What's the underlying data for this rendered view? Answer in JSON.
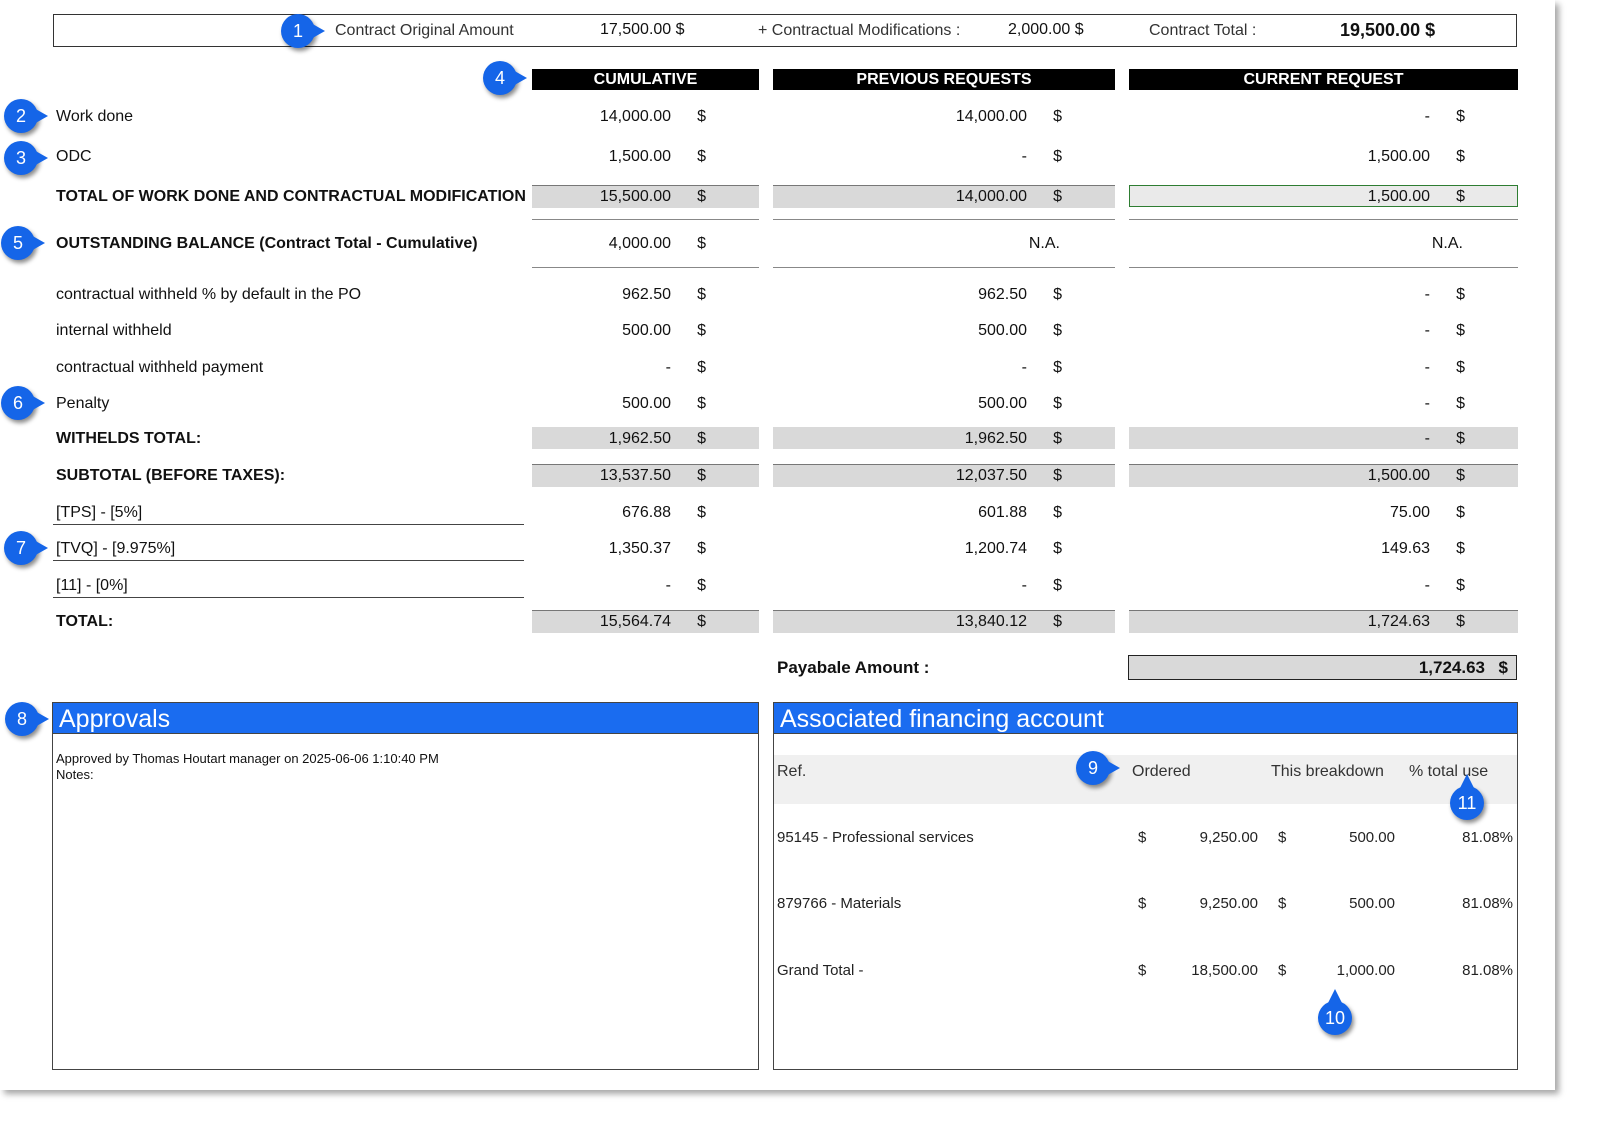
{
  "header": {
    "original_label": "Contract Original Amount",
    "original_value": "17,500.00 $",
    "mods_label": "+ Contractual Modifications :",
    "mods_value": "2,000.00 $",
    "total_label": "Contract Total :",
    "total_value": "19,500.00 $"
  },
  "columns": [
    "CUMULATIVE",
    "PREVIOUS REQUESTS",
    "CURRENT REQUEST"
  ],
  "currency": "$",
  "rows": {
    "work_done": {
      "label": "Work done",
      "values": [
        "14,000.00",
        "14,000.00",
        "-"
      ]
    },
    "odc": {
      "label": "ODC",
      "values": [
        "1,500.00",
        "-",
        "1,500.00"
      ]
    },
    "total_work": {
      "label": "TOTAL OF WORK DONE AND CONTRACTUAL MODIFICATION",
      "values": [
        "15,500.00",
        "14,000.00",
        "1,500.00"
      ]
    },
    "outstanding": {
      "label": "OUTSTANDING BALANCE (Contract Total - Cumulative)",
      "values": [
        "4,000.00",
        "N.A.",
        "N.A."
      ]
    },
    "contract_withheld": {
      "label": "contractual withheld % by default in the PO",
      "values": [
        "962.50",
        "962.50",
        "-"
      ]
    },
    "internal_withheld": {
      "label": "internal withheld",
      "values": [
        "500.00",
        "500.00",
        "-"
      ]
    },
    "withheld_payment": {
      "label": "contractual withheld payment",
      "values": [
        "-",
        "-",
        "-"
      ]
    },
    "penalty": {
      "label": "Penalty",
      "values": [
        "500.00",
        "500.00",
        "-"
      ]
    },
    "withheld_total": {
      "label": "WITHELDS TOTAL:",
      "values": [
        "1,962.50",
        "1,962.50",
        "-"
      ]
    },
    "subtotal": {
      "label": "SUBTOTAL (BEFORE TAXES):",
      "values": [
        "13,537.50",
        "12,037.50",
        "1,500.00"
      ]
    },
    "tps": {
      "label": "[TPS] - [5%]",
      "values": [
        "676.88",
        "601.88",
        "75.00"
      ]
    },
    "tvq": {
      "label": "[TVQ] - [9.975%]",
      "values": [
        "1,350.37",
        "1,200.74",
        "149.63"
      ]
    },
    "tax11": {
      "label": "[11] - [0%]",
      "values": [
        "-",
        "-",
        "-"
      ]
    },
    "total": {
      "label": "TOTAL:",
      "values": [
        "15,564.74",
        "13,840.12",
        "1,724.63"
      ]
    }
  },
  "payable": {
    "label": "Payabale Amount :",
    "value": "1,724.63",
    "currency": "$"
  },
  "approvals": {
    "title": "Approvals",
    "line1": "Approved by Thomas Houtart manager on 2025-06-06 1:10:40 PM",
    "line2": "Notes:"
  },
  "financing": {
    "title": "Associated financing account",
    "headers": {
      "ref": "Ref.",
      "ordered": "Ordered",
      "breakdown": "This breakdown",
      "use": "% total use"
    },
    "rows": [
      {
        "ref": "95145 - Professional services",
        "ordered": "9,250.00",
        "breakdown": "500.00",
        "use": "81.08%"
      },
      {
        "ref": "879766 - Materials",
        "ordered": "9,250.00",
        "breakdown": "500.00",
        "use": "81.08%"
      },
      {
        "ref": "Grand Total -",
        "ordered": "18,500.00",
        "breakdown": "1,000.00",
        "use": "81.08%"
      }
    ]
  },
  "callouts": [
    "1",
    "2",
    "3",
    "4",
    "5",
    "6",
    "7",
    "8",
    "9",
    "10",
    "11"
  ],
  "colors": {
    "accent": "#1a6cf0",
    "callout": "#1565e8",
    "header_bg": "#000000",
    "total_bg": "#d9d9d9"
  }
}
